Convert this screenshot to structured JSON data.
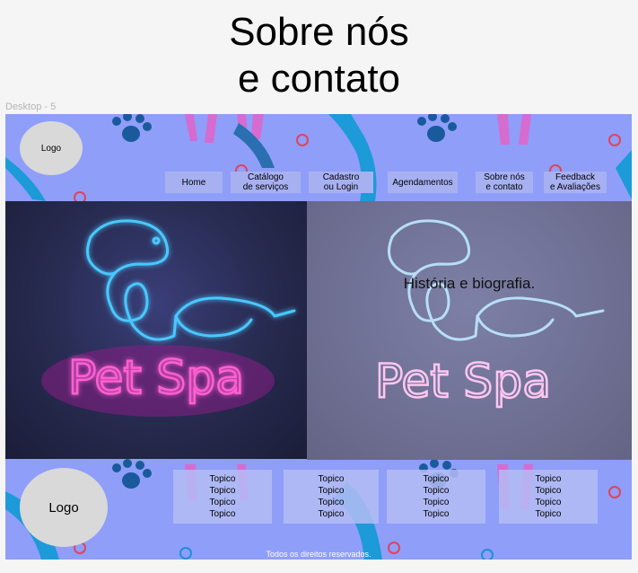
{
  "page": {
    "title_line1": "Sobre nós",
    "title_line2": "e contato",
    "frame_label": "Desktop - 5"
  },
  "header": {
    "logo_text": "Logo",
    "nav": [
      {
        "line1": "Home",
        "line2": ""
      },
      {
        "line1": "Catálogo",
        "line2": "de serviços"
      },
      {
        "line1": "Cadastro",
        "line2": "ou Login"
      },
      {
        "line1": "Agendamentos",
        "line2": ""
      },
      {
        "line1": "Sobre nós",
        "line2": "e contato"
      },
      {
        "line1": "Feedback",
        "line2": "e Avaliações"
      }
    ]
  },
  "hero": {
    "sign_text": "Pet Spa",
    "history_text": "História e biografia."
  },
  "footer": {
    "logo_text": "Logo",
    "topic_columns": [
      [
        "Topico",
        "Topico",
        "Topico",
        "Topico"
      ],
      [
        "Topico",
        "Topico",
        "Topico",
        "Topico"
      ],
      [
        "Topico",
        "Topico",
        "Topico",
        "Topico"
      ],
      [
        "Topico",
        "Topico",
        "Topico",
        "Topico"
      ]
    ],
    "rights": "Todos os direitos reservados."
  },
  "colors": {
    "background": "#8f9ef9",
    "neon_blue": "#3fc3ff",
    "neon_pink": "#ff3cc8"
  }
}
